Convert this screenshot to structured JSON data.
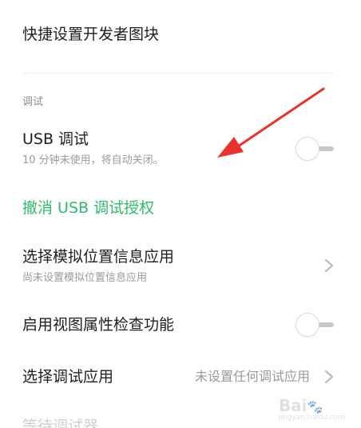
{
  "quick_tiles": {
    "title": "快捷设置开发者图块"
  },
  "section": {
    "label": "调试"
  },
  "usb_debug": {
    "title": "USB 调试",
    "subtitle": "10 分钟未使用，将自动关闭。",
    "enabled": false
  },
  "revoke": {
    "label": "撤消 USB 调试授权",
    "color": "#2ebb6c"
  },
  "mock_location": {
    "title": "选择模拟位置信息应用",
    "subtitle": "尚未设置模拟位置信息应用"
  },
  "view_attr": {
    "title": "启用视图属性检查功能",
    "enabled": false
  },
  "debug_app": {
    "title": "选择调试应用",
    "value": "未设置任何调试应用"
  },
  "wait_debugger": {
    "title": "等待调试器"
  },
  "annotation": {
    "color": "#e8332d"
  },
  "watermark": {
    "text": "Bai",
    "sub": "jingyan.baidu.com"
  }
}
